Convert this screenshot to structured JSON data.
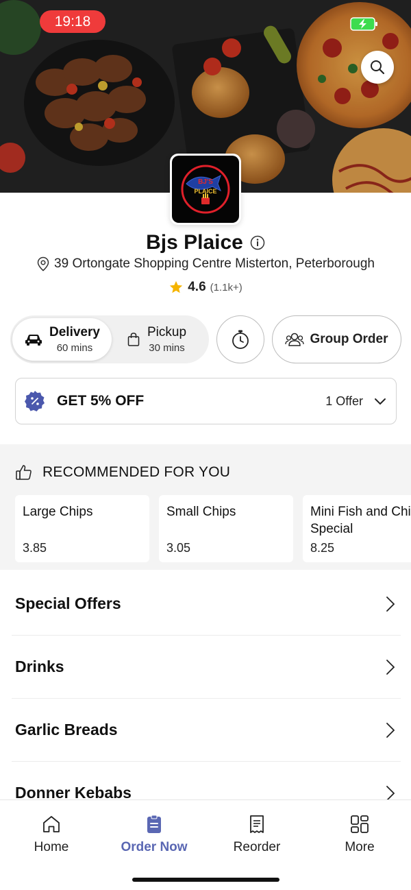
{
  "status_bar": {
    "time": "19:18"
  },
  "restaurant": {
    "name": "Bjs Plaice",
    "address": "39 Ortongate Shopping Centre Misterton, Peterborough",
    "rating": "4.6",
    "rating_count": "(1.1k+)",
    "logo_text_line1": "BJ'S",
    "logo_text_line2": "PLAICE"
  },
  "order_modes": {
    "delivery": {
      "label": "Delivery",
      "time": "60 mins"
    },
    "pickup": {
      "label": "Pickup",
      "time": "30 mins"
    }
  },
  "group_order_label": "Group Order",
  "offer": {
    "title": "GET 5% OFF",
    "count": "1 Offer"
  },
  "recommended": {
    "title": "RECOMMENDED FOR YOU",
    "items": [
      {
        "name": "Large Chips",
        "price": "3.85"
      },
      {
        "name": "Small Chips",
        "price": "3.05"
      },
      {
        "name": "Mini Fish and Chips Special",
        "price": "8.25"
      }
    ]
  },
  "categories": [
    "Special Offers",
    "Drinks",
    "Garlic Breads",
    "Donner Kebabs"
  ],
  "bottom_nav": [
    {
      "label": "Home",
      "icon": "home-icon",
      "active": false
    },
    {
      "label": "Order Now",
      "icon": "order-icon",
      "active": true
    },
    {
      "label": "Reorder",
      "icon": "receipt-icon",
      "active": false
    },
    {
      "label": "More",
      "icon": "grid-icon",
      "active": false
    }
  ],
  "colors": {
    "accent": "#5a67b3",
    "status_red": "#ef3b3b",
    "star": "#f5b400",
    "battery": "#3ddc4f"
  }
}
